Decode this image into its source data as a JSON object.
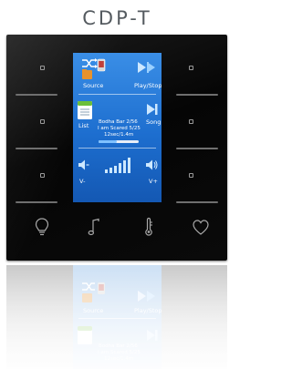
{
  "title": "CDP-T",
  "screen": {
    "source_label": "Source",
    "play_stop_label": "Play/Stop",
    "list_label": "List",
    "song_label": "Song",
    "now_playing": {
      "track_line": "Bodha Bar 2/56",
      "song_line": "I am Scared 5/25",
      "time_line": "12sec/1.4m",
      "progress": 0.45
    },
    "vol_down_label": "V-",
    "vol_up_label": "V+"
  },
  "bottom_icons": [
    "light-bulb-icon",
    "music-note-icon",
    "thermometer-icon",
    "heart-icon"
  ],
  "colors": {
    "panel": "#0a0a0a",
    "screen": "#1d6ecf",
    "title": "#555b60"
  }
}
